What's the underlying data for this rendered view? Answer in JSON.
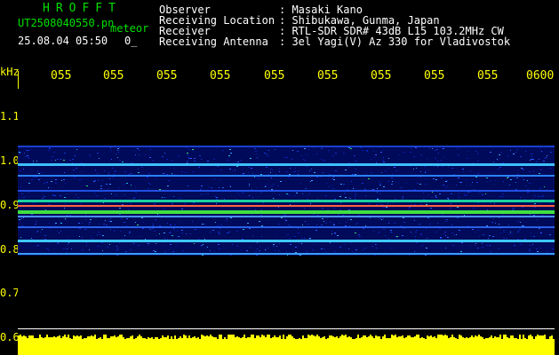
{
  "header": {
    "app_title": "HROFFT",
    "filename": "UT2508040550.pn",
    "tag": "meteor",
    "datetime": "25.08.04 05:50",
    "count": "0_",
    "fields": [
      {
        "label": "Observer",
        "value": ": Masaki Kano"
      },
      {
        "label": "Receiving Location",
        "value": ": Shibukawa, Gunma, Japan"
      },
      {
        "label": "Receiver",
        "value": ": RTL-SDR SDR# 43dB L15 103.2MHz CW"
      },
      {
        "label": "Receiving Antenna",
        "value": ": 3el Yagi(V) Az 330 for Vladivostok"
      }
    ]
  },
  "axis": {
    "unit": "kHz",
    "y_ticks": [
      "1.1",
      "1.0",
      "0.9",
      "0.8",
      "0.7",
      "0.6"
    ],
    "x_ticks": [
      "055",
      "055",
      "055",
      "055",
      "055",
      "055",
      "055",
      "055",
      "055",
      "0600"
    ]
  },
  "colors": {
    "text": "#ffffff",
    "title": "#00e000",
    "axis": "#ffff00",
    "background": "#000000"
  }
}
